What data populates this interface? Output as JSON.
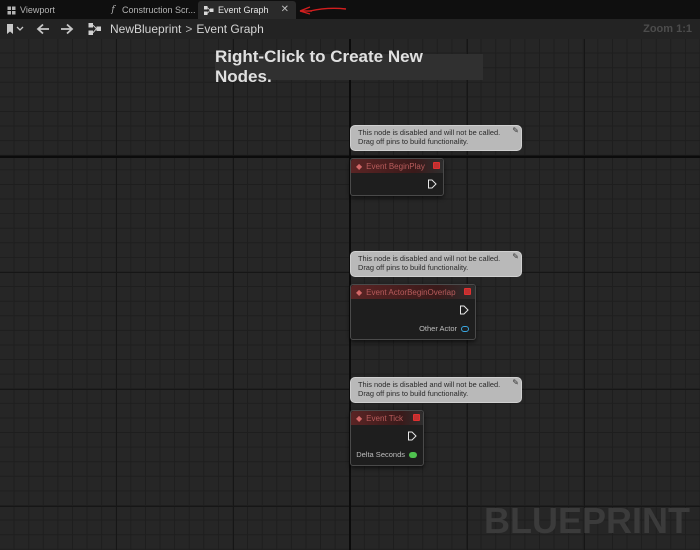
{
  "tabs": [
    {
      "label": "Viewport",
      "icon": "viewport-icon"
    },
    {
      "label": "Construction Scr...",
      "icon": "function-icon"
    },
    {
      "label": "Event Graph",
      "icon": "graph-icon",
      "active": true
    }
  ],
  "toolbar": {
    "breadcrumb": [
      "NewBlueprint",
      "Event Graph"
    ],
    "separator": ">",
    "zoom": "Zoom 1:1"
  },
  "graph": {
    "hint": "Right-Click to Create New Nodes.",
    "watermark": "BLUEPRINT",
    "disabled_comment": [
      "This node is disabled and will not be called.",
      "Drag off pins to build functionality."
    ]
  },
  "nodes": [
    {
      "title": "Event BeginPlay",
      "outputs": []
    },
    {
      "title": "Event ActorBeginOverlap",
      "outputs": [
        {
          "label": "Other Actor",
          "pin_color": "#3aa7e0"
        }
      ]
    },
    {
      "title": "Event Tick",
      "outputs": [
        {
          "label": "Delta Seconds",
          "pin_color": "#4fc24f"
        }
      ]
    }
  ],
  "colors": {
    "accent_annotation": "#d21e1e",
    "event_header": "#5a2424",
    "delegate_pin": "#c03030"
  }
}
